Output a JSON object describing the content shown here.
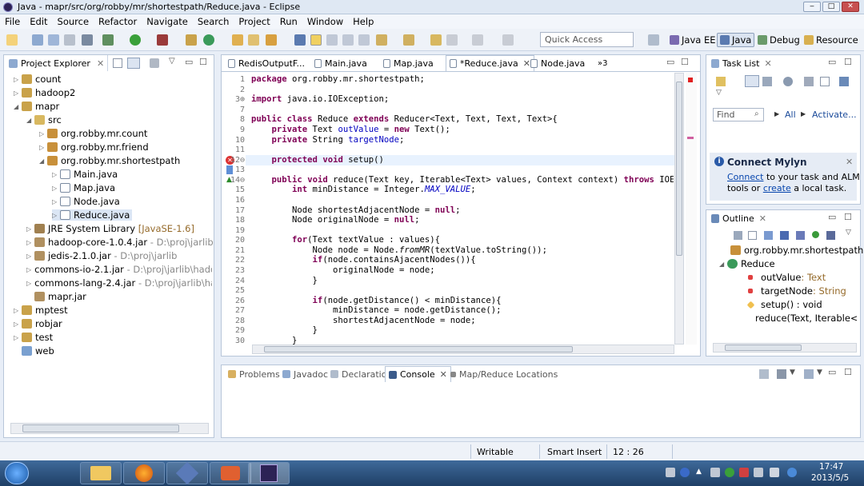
{
  "window": {
    "title": "Java - mapr/src/org/robby/mr/shortestpath/Reduce.java - Eclipse",
    "min": "‒",
    "max": "□",
    "close": "✕"
  },
  "menu": [
    "File",
    "Edit",
    "Source",
    "Refactor",
    "Navigate",
    "Search",
    "Project",
    "Run",
    "Window",
    "Help"
  ],
  "quick_access": "Quick Access",
  "perspectives": {
    "java_ee": "Java EE",
    "java": "Java",
    "debug": "Debug",
    "resource": "Resource"
  },
  "project_explorer": {
    "title": "Project Explorer",
    "items": [
      {
        "label": "count",
        "extra": ""
      },
      {
        "label": "hadoop2",
        "extra": ""
      },
      {
        "label": "mapr",
        "extra": ""
      },
      {
        "label": "src",
        "extra": ""
      },
      {
        "label": "org.robby.mr.count",
        "extra": ""
      },
      {
        "label": "org.robby.mr.friend",
        "extra": ""
      },
      {
        "label": "org.robby.mr.shortestpath",
        "extra": ""
      },
      {
        "label": "Main.java",
        "extra": ""
      },
      {
        "label": "Map.java",
        "extra": ""
      },
      {
        "label": "Node.java",
        "extra": ""
      },
      {
        "label": "Reduce.java",
        "extra": ""
      },
      {
        "label": "JRE System Library",
        "extra": "[JavaSE-1.6]"
      },
      {
        "label": "hadoop-core-1.0.4.jar",
        "extra": "- D:\\proj\\jarlib"
      },
      {
        "label": "jedis-2.1.0.jar",
        "extra": "- D:\\proj\\jarlib"
      },
      {
        "label": "commons-io-2.1.jar",
        "extra": "- D:\\proj\\jarlib\\hado"
      },
      {
        "label": "commons-lang-2.4.jar",
        "extra": "- D:\\proj\\jarlib\\ha"
      },
      {
        "label": "mapr.jar",
        "extra": ""
      },
      {
        "label": "mptest",
        "extra": ""
      },
      {
        "label": "robjar",
        "extra": ""
      },
      {
        "label": "test",
        "extra": ""
      },
      {
        "label": "web",
        "extra": ""
      }
    ]
  },
  "editor": {
    "tabs": [
      "RedisOutputF...",
      "Main.java",
      "Map.java",
      "*Reduce.java",
      "Node.java"
    ],
    "overflow": "»3",
    "lines": [
      {
        "n": "1",
        "t": "package org.robby.mr.shortestpath;"
      },
      {
        "n": "2",
        "t": ""
      },
      {
        "n": "3⊕",
        "t": "import java.io.IOException;"
      },
      {
        "n": "7",
        "t": ""
      },
      {
        "n": "8",
        "t": "public class Reduce extends Reducer<Text, Text, Text, Text>{"
      },
      {
        "n": "9",
        "t": "    private Text outValue = new Text();"
      },
      {
        "n": "10",
        "t": "    private String targetNode;"
      },
      {
        "n": "11",
        "t": ""
      },
      {
        "n": "12⊖",
        "t": "    protected void setup()"
      },
      {
        "n": "13",
        "t": ""
      },
      {
        "n": "14⊖",
        "t": "    public void reduce(Text key, Iterable<Text> values, Context context) throws IOExcepti"
      },
      {
        "n": "15",
        "t": "        int minDistance = Integer.MAX_VALUE;"
      },
      {
        "n": "16",
        "t": ""
      },
      {
        "n": "17",
        "t": "        Node shortestAdjacentNode = null;"
      },
      {
        "n": "18",
        "t": "        Node originalNode = null;"
      },
      {
        "n": "19",
        "t": ""
      },
      {
        "n": "20",
        "t": "        for(Text textValue : values){"
      },
      {
        "n": "21",
        "t": "            Node node = Node.fromMR(textValue.toString());"
      },
      {
        "n": "22",
        "t": "            if(node.containsAjacentNodes()){"
      },
      {
        "n": "23",
        "t": "                originalNode = node;"
      },
      {
        "n": "24",
        "t": "            }"
      },
      {
        "n": "25",
        "t": ""
      },
      {
        "n": "26",
        "t": "            if(node.getDistance() < minDistance){"
      },
      {
        "n": "27",
        "t": "                minDistance = node.getDistance();"
      },
      {
        "n": "28",
        "t": "                shortestAdjacentNode = node;"
      },
      {
        "n": "29",
        "t": "            }"
      },
      {
        "n": "30",
        "t": "        }"
      }
    ]
  },
  "task_list": {
    "title": "Task List",
    "find_placeholder": "Find",
    "all": "All",
    "activate": "Activate..."
  },
  "mylyn": {
    "title": "Connect Mylyn",
    "connect": "Connect",
    "text1": " to your task and ALM",
    "text2": "tools or ",
    "create": "create",
    "text3": " a local task."
  },
  "outline": {
    "title": "Outline",
    "items": [
      {
        "label": "org.robby.mr.shortestpath",
        "type": ""
      },
      {
        "label": "Reduce",
        "type": ""
      },
      {
        "label": "outValue",
        "type": " : Text"
      },
      {
        "label": "targetNode",
        "type": " : String"
      },
      {
        "label": "setup() : void",
        "type": ""
      },
      {
        "label": "reduce(Text, Iterable<Te",
        "type": ""
      }
    ]
  },
  "console": {
    "tabs": [
      "Problems",
      "Javadoc",
      "Declaration",
      "Console",
      "Map/Reduce Locations"
    ]
  },
  "status": {
    "writable": "Writable",
    "insert": "Smart Insert",
    "position": "12 : 26"
  },
  "clock": {
    "time": "17:47",
    "date": "2013/5/5"
  },
  "colors": {
    "keyword": "#7f0055",
    "field": "#0000c0",
    "link": "#0645ad",
    "selection": "#dbe6f5"
  }
}
